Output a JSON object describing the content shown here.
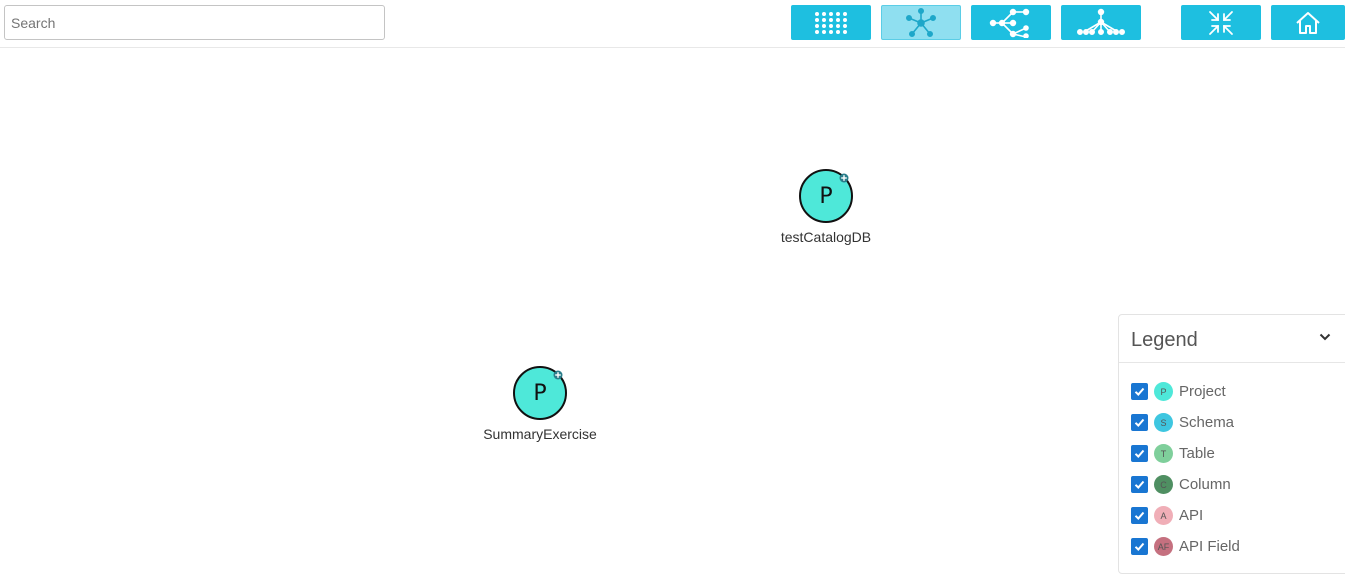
{
  "search": {
    "placeholder": "Search",
    "value": ""
  },
  "toolbar": {
    "buttons": [
      {
        "icon": "grid-layout-icon",
        "active": false
      },
      {
        "icon": "force-layout-icon",
        "active": true
      },
      {
        "icon": "tree-horizontal-layout-icon",
        "active": false
      },
      {
        "icon": "tree-vertical-layout-icon",
        "active": false
      },
      {
        "icon": "collapse-icon",
        "active": false
      },
      {
        "icon": "home-icon",
        "active": false
      }
    ],
    "colors": {
      "button": "#1ebfe0",
      "active": "#8fdff0"
    }
  },
  "graph": {
    "nodes": [
      {
        "letter": "P",
        "label": "testCatalogDB",
        "type": "Project"
      },
      {
        "letter": "P",
        "label": "SummaryExercise",
        "type": "Project"
      }
    ]
  },
  "legend": {
    "title": "Legend",
    "items": [
      {
        "abbr": "P",
        "label": "Project",
        "color": "#4ee8d9",
        "checked": true
      },
      {
        "abbr": "S",
        "label": "Schema",
        "color": "#3ec6e0",
        "checked": true
      },
      {
        "abbr": "T",
        "label": "Table",
        "color": "#7fcf9b",
        "checked": true
      },
      {
        "abbr": "C",
        "label": "Column",
        "color": "#4f8f62",
        "checked": true
      },
      {
        "abbr": "A",
        "label": "API",
        "color": "#f0aeb7",
        "checked": true
      },
      {
        "abbr": "AF",
        "label": "API Field",
        "color": "#c5707f",
        "checked": true
      }
    ]
  }
}
